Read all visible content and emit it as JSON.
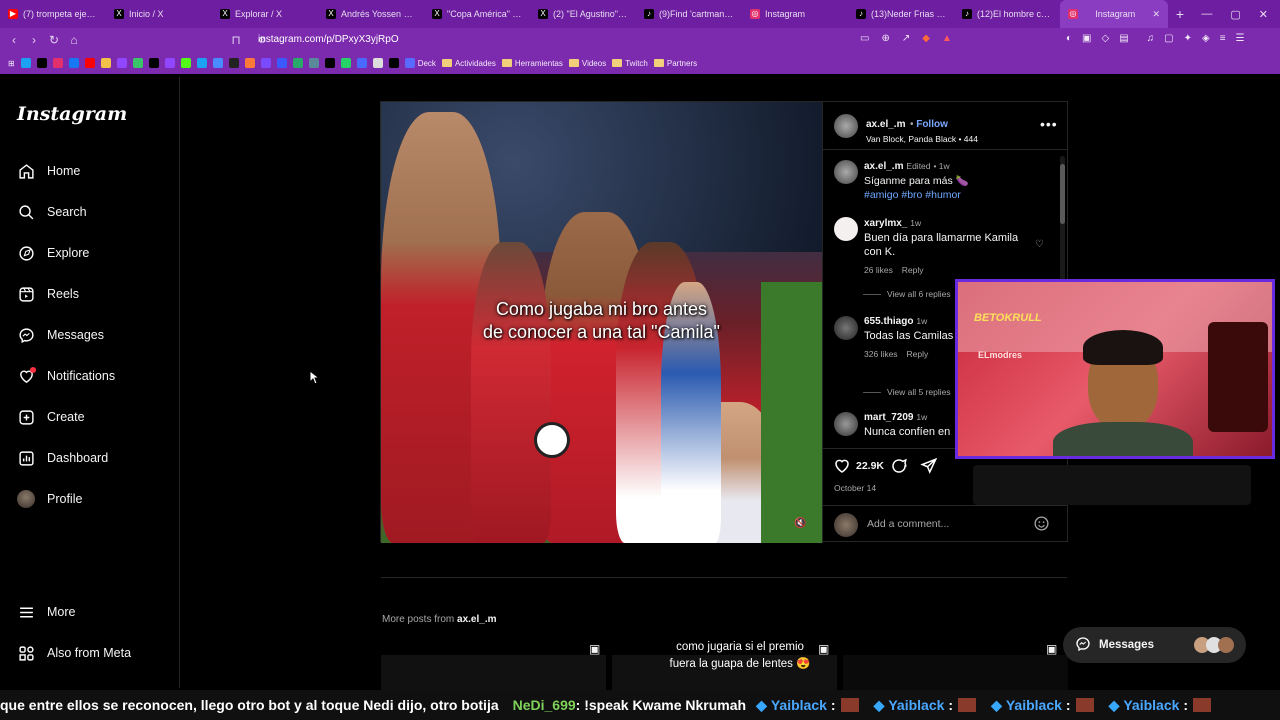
{
  "browser": {
    "tabs": [
      {
        "label": "(7) trompeta ejercic",
        "icon": "youtube-icon",
        "color": "#ff0000"
      },
      {
        "label": "Inicio / X",
        "icon": "x-icon",
        "color": "#000000"
      },
      {
        "label": "Explorar / X",
        "icon": "x-icon",
        "color": "#000000"
      },
      {
        "label": "Andrés Yossen ao 🌟",
        "icon": "x-icon",
        "color": "#000000"
      },
      {
        "label": "\"Copa América\" - B",
        "icon": "x-icon",
        "color": "#000000"
      },
      {
        "label": "(2) \"El Agustino\" - B",
        "icon": "x-icon",
        "color": "#000000"
      },
      {
        "label": "(9)Find 'cartman mi",
        "icon": "tiktok-icon",
        "color": "#000000"
      },
      {
        "label": "Instagram",
        "icon": "instagram-icon",
        "color": "#e1306c"
      },
      {
        "label": "(13)Neder Frias (@",
        "icon": "tiktok-icon",
        "color": "#000000"
      },
      {
        "label": "(12)El hombre con e",
        "icon": "tiktok-icon",
        "color": "#000000"
      },
      {
        "label": "Instagram",
        "icon": "instagram-icon",
        "color": "#e1306c",
        "active": true
      }
    ],
    "new_tab": "+",
    "url": "instagram.com/p/DPxyX3yjRpO",
    "bookmarks": [
      "Deck",
      "Actividades",
      "Herramientas",
      "Videos",
      "Twitch",
      "Partners"
    ]
  },
  "sidebar": {
    "logo": "Instagram",
    "items": [
      {
        "label": "Home",
        "icon": "home-icon"
      },
      {
        "label": "Search",
        "icon": "search-icon"
      },
      {
        "label": "Explore",
        "icon": "compass-icon"
      },
      {
        "label": "Reels",
        "icon": "reels-icon"
      },
      {
        "label": "Messages",
        "icon": "messenger-icon"
      },
      {
        "label": "Notifications",
        "icon": "heart-icon"
      },
      {
        "label": "Create",
        "icon": "plus-square-icon"
      },
      {
        "label": "Dashboard",
        "icon": "chart-icon"
      },
      {
        "label": "Profile",
        "icon": "avatar-icon"
      }
    ],
    "bottom": [
      {
        "label": "More",
        "icon": "menu-icon"
      },
      {
        "label": "Also from Meta",
        "icon": "meta-icon"
      }
    ]
  },
  "post": {
    "video_caption_line1": "Como jugaba mi bro antes",
    "video_caption_line2": "de conocer a una tal \"Camila\"",
    "author": "ax.el_.m",
    "follow": "Follow",
    "audio": "Van Block, Panda Black • 444",
    "caption_user": "ax.el_.m",
    "caption_edited": "Edited",
    "caption_time": "1w",
    "caption_text": "Síganme para más 🍆",
    "caption_tags": "#amigo #bro #humor",
    "comments": [
      {
        "user": "xarylmx_",
        "time": "1w",
        "text": "Buen día para llamarme Kamila con K.",
        "likes": "26 likes",
        "reply": "Reply",
        "view_replies": "View all 6 replies"
      },
      {
        "user": "655.thiago",
        "time": "1w",
        "text": "Todas las Camilas 😳",
        "likes": "326 likes",
        "reply": "Reply",
        "view_replies": "View all 5 replies"
      },
      {
        "user": "mart_7209",
        "time": "1w",
        "text": "Nunca confíen en"
      }
    ],
    "like_count": "22.9K",
    "date": "October 14",
    "add_comment_placeholder": "Add a comment..."
  },
  "more_posts": {
    "prefix": "More posts from",
    "user": "ax.el_.m"
  },
  "subtitle": {
    "line1": "como jugaria si el premio",
    "line2": "fuera la guapa de lentes 😍"
  },
  "messages_pill": {
    "label": "Messages"
  },
  "stream_overlay": {
    "text1": "BETOKRULL",
    "text2": "ELmodres"
  },
  "ticker": {
    "text1": "que entre ellos se reconocen, llego otro bot y al toque Nedi dijo, otro botija",
    "user1": "NeDi_699",
    "text2": ": !speak Kwame Nkrumah",
    "repeated_user": "Yaiblack",
    "sep": ":"
  },
  "colors": {
    "accent": "#0095f6",
    "browser": "#7c2aae",
    "overlay_border": "#6a2adf"
  }
}
